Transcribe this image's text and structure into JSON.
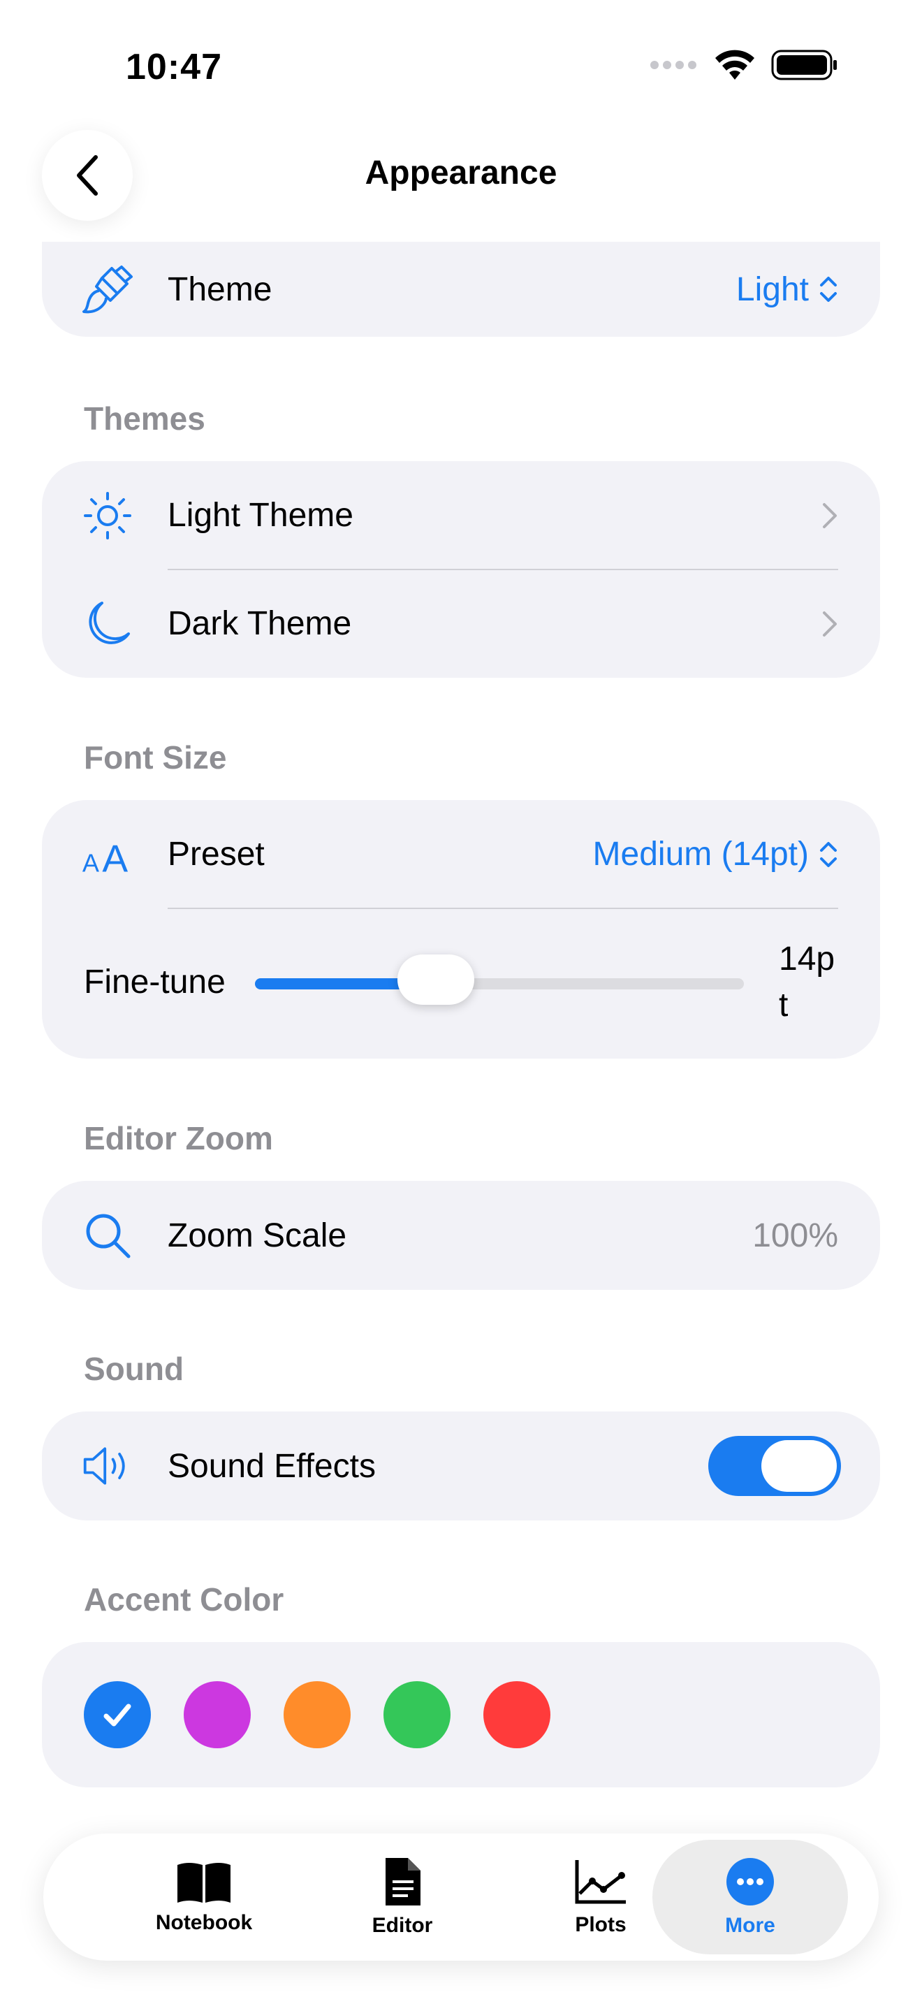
{
  "status": {
    "time": "10:47"
  },
  "nav": {
    "title": "Appearance"
  },
  "theme_row": {
    "label": "Theme",
    "value": "Light"
  },
  "themes": {
    "header": "Themes",
    "items": [
      {
        "label": "Light Theme"
      },
      {
        "label": "Dark Theme"
      }
    ]
  },
  "font_size": {
    "header": "Font Size",
    "preset_label": "Preset",
    "preset_value": "Medium (14pt)",
    "finetune_label": "Fine-tune",
    "finetune_value": "14pt",
    "finetune_fraction": 0.32
  },
  "editor_zoom": {
    "header": "Editor Zoom",
    "label": "Zoom Scale",
    "value": "100%"
  },
  "sound": {
    "header": "Sound",
    "label": "Sound Effects",
    "enabled": true
  },
  "accent": {
    "header": "Accent Color",
    "colors": [
      "#1a7cf0",
      "#cc38e0",
      "#ff8c2a",
      "#34c759",
      "#ff3b3b"
    ],
    "selected": "#1a7cf0"
  },
  "tabs": [
    {
      "label": "Notebook",
      "icon": "book-icon"
    },
    {
      "label": "Editor",
      "icon": "document-icon"
    },
    {
      "label": "Plots",
      "icon": "chart-icon"
    },
    {
      "label": "More",
      "icon": "more-icon"
    }
  ],
  "colors": {
    "accent": "#1a7cf0",
    "secondary": "#8e8e93",
    "card": "#f2f2f7"
  }
}
